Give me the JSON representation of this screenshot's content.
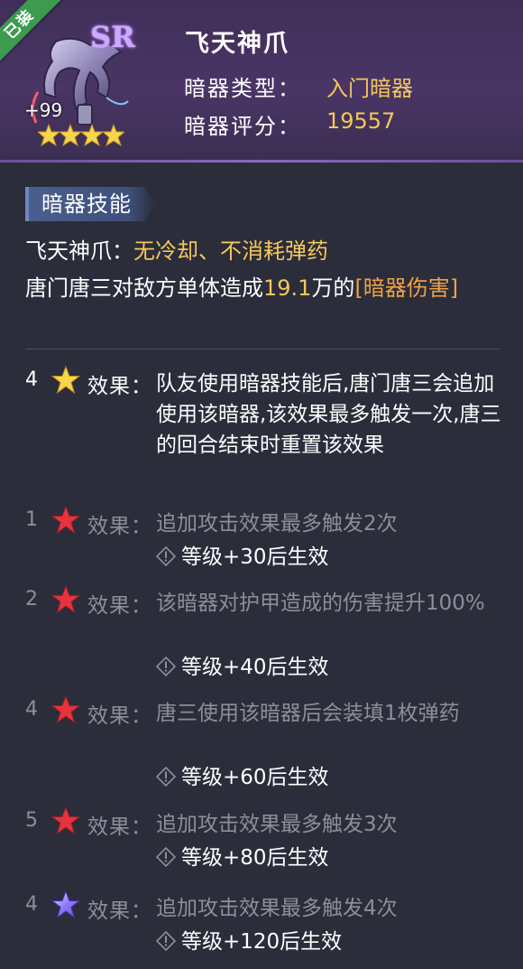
{
  "header": {
    "equipped_badge": "已装",
    "rarity": "SR",
    "level": "+99",
    "star_count": 4,
    "name": "飞天神爪",
    "type_label": "暗器类型：",
    "type_value": "入门暗器",
    "score_label": "暗器评分：",
    "score_value": "19557"
  },
  "skill": {
    "tag": "暗器技能",
    "name": "飞天神爪：",
    "traits": "无冷却、不消耗弹药",
    "text_pre": "唐门唐三对敌方单体造成",
    "damage": "19.1",
    "text_mid": "万的",
    "damage_type": "[暗器伤害]"
  },
  "effects": [
    {
      "stars": "4",
      "star_color": "gold",
      "active": true,
      "label": "效果：",
      "desc": "队友使用暗器技能后,唐门唐三会追加使用该暗器,该效果最多触发一次,唐三的回合结束时重置该效果"
    },
    {
      "stars": "1",
      "star_color": "red",
      "active": false,
      "label": "效果：",
      "desc": "追加攻击效果最多触发2次",
      "req": "等级+30后生效"
    },
    {
      "stars": "2",
      "star_color": "red",
      "active": false,
      "label": "效果：",
      "desc": "该暗器对护甲造成的伤害提升100%",
      "req": "等级+40后生效"
    },
    {
      "stars": "4",
      "star_color": "red",
      "active": false,
      "label": "效果：",
      "desc": "唐三使用该暗器后会装填1枚弹药",
      "req": "等级+60后生效"
    },
    {
      "stars": "5",
      "star_color": "red",
      "active": false,
      "label": "效果：",
      "desc": "追加攻击效果最多触发3次",
      "req": "等级+80后生效"
    },
    {
      "stars": "4",
      "star_color": "purple",
      "active": false,
      "label": "效果：",
      "desc": "追加攻击效果最多触发4次",
      "req": "等级+120后生效"
    }
  ],
  "colors": {
    "gold": "#f5c85a",
    "orange": "#f0a146",
    "muted": "#8c8f9b",
    "badge_green": "#3c9b4e"
  }
}
